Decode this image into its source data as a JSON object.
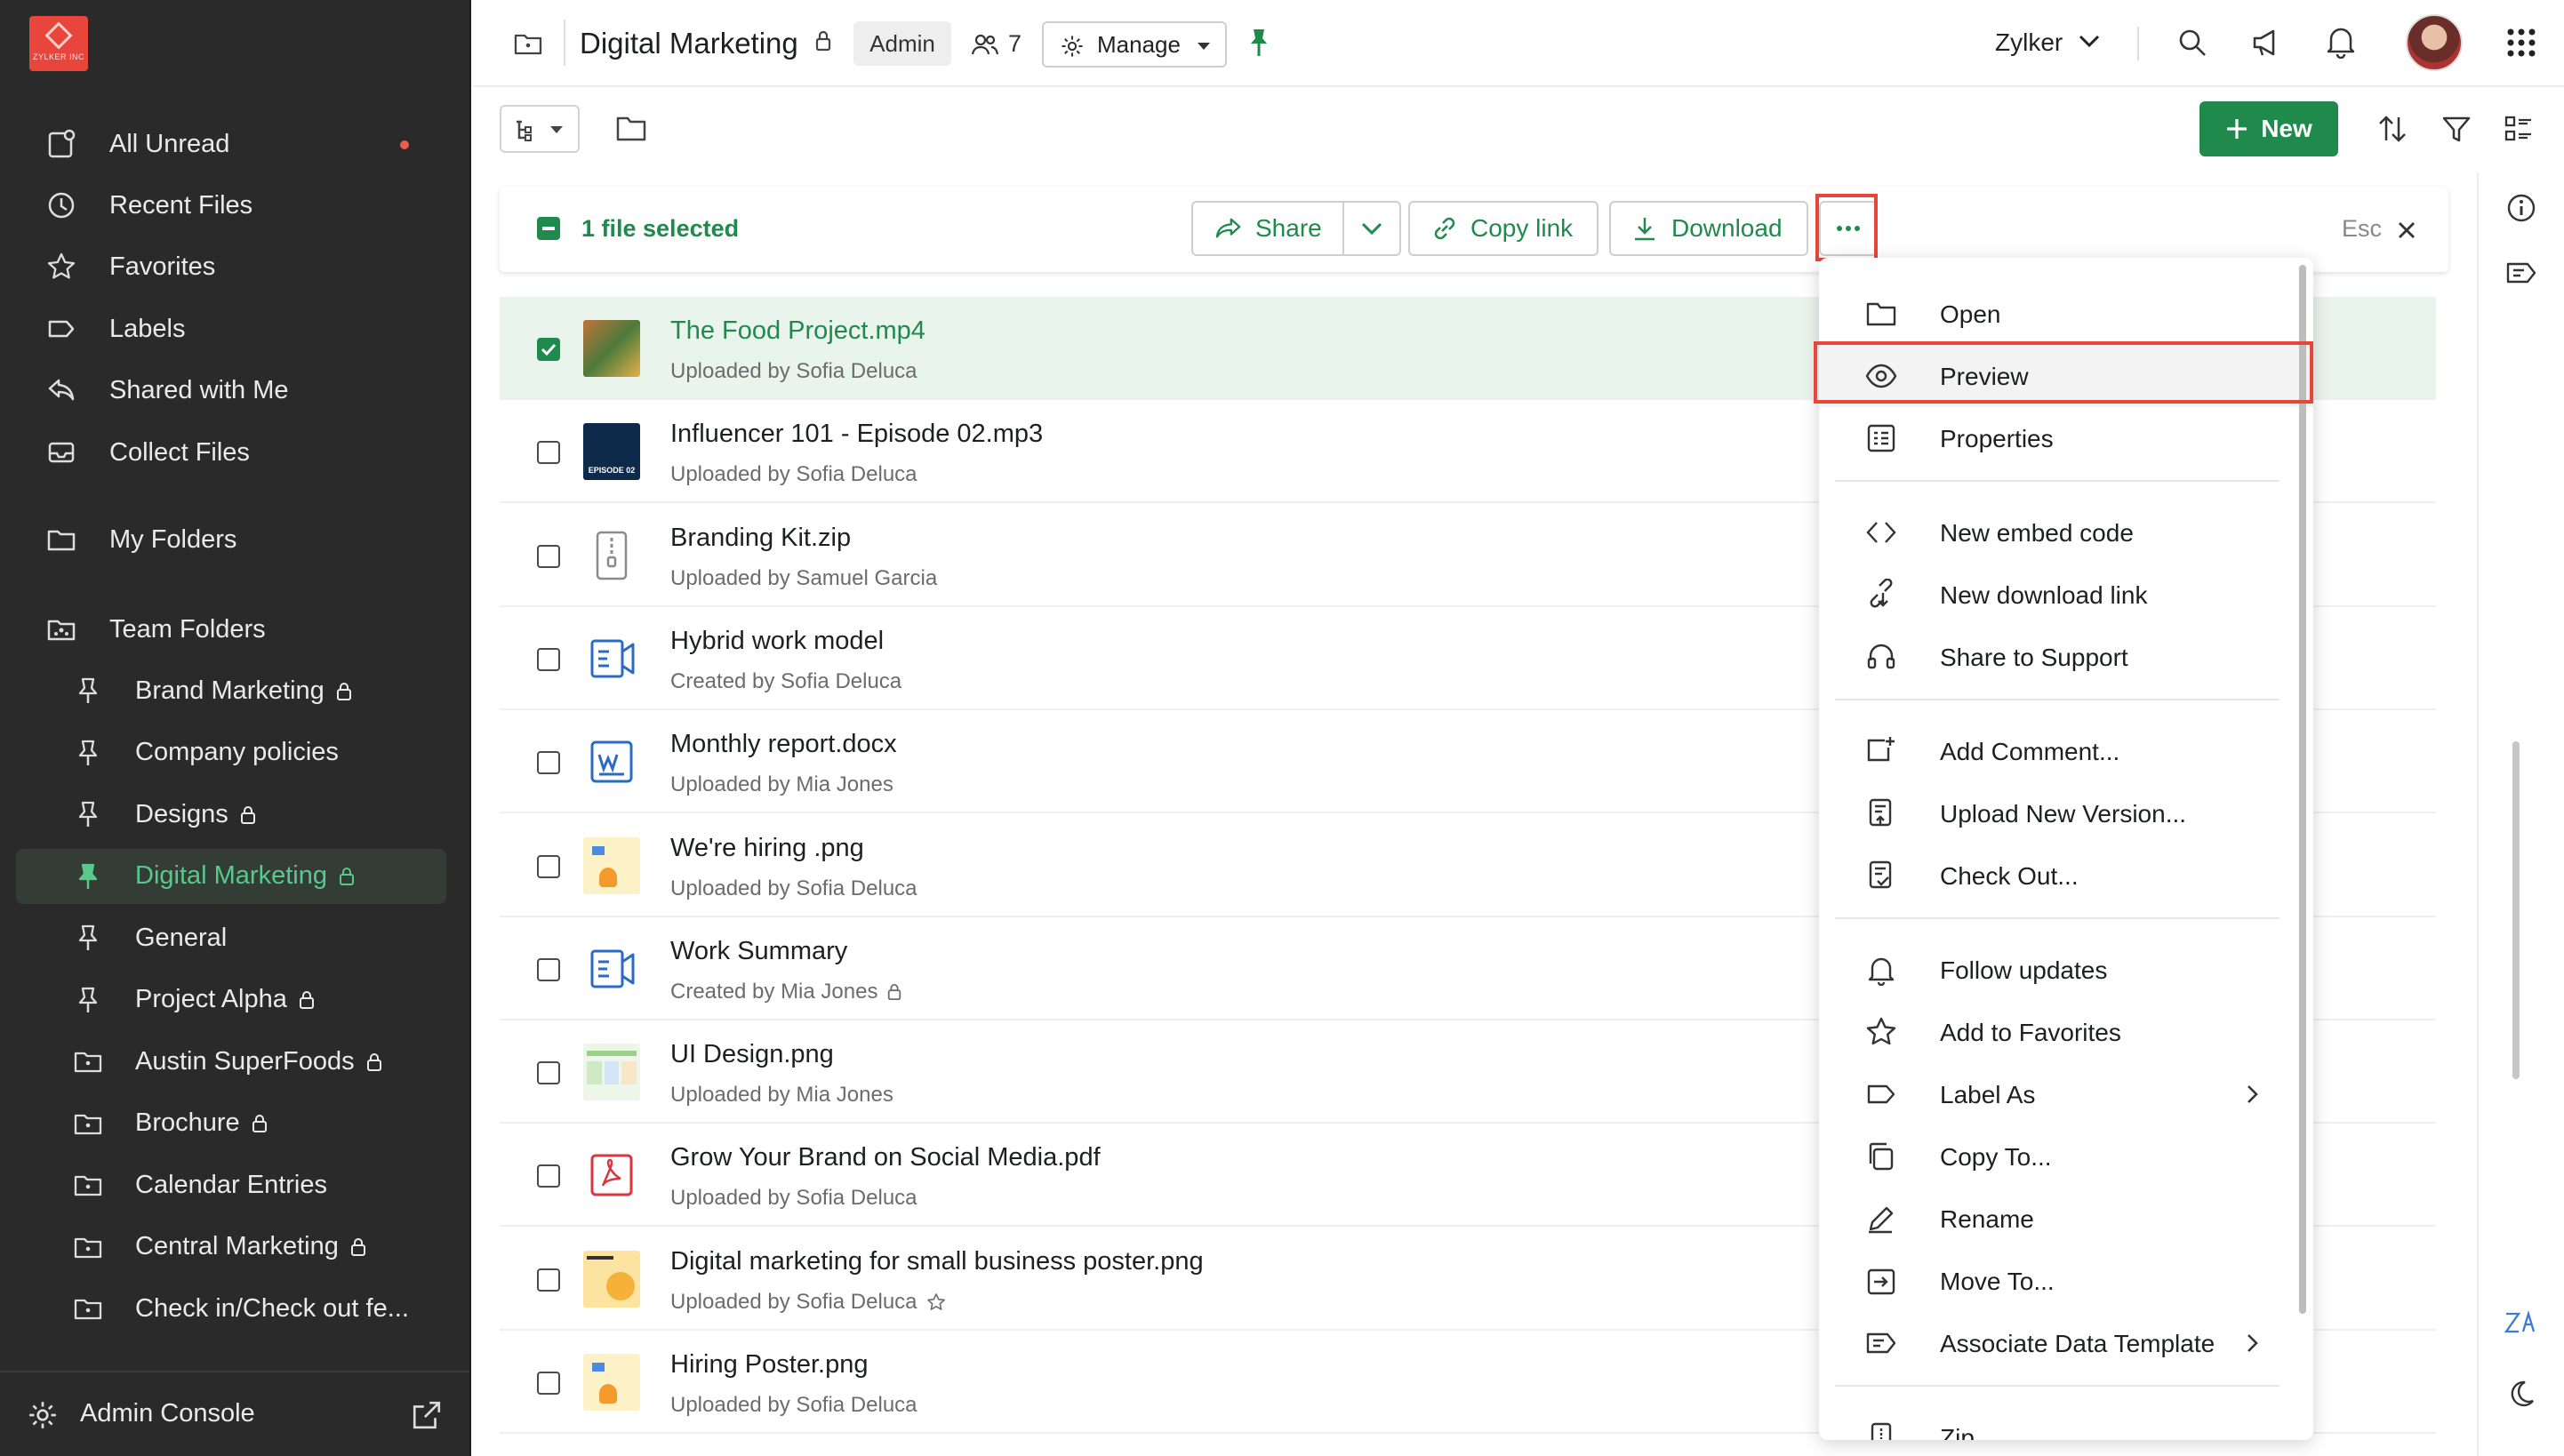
{
  "colors": {
    "accent": "#1f8a4c",
    "sidebar_bg": "#2a2a2a",
    "highlight": "#e8453c"
  },
  "logo_text": "ZYLKER INC",
  "sidebar": {
    "items": [
      {
        "label": "All Unread",
        "icon": "unread-icon"
      },
      {
        "label": "Recent Files",
        "icon": "clock-icon"
      },
      {
        "label": "Favorites",
        "icon": "star-icon"
      },
      {
        "label": "Labels",
        "icon": "label-icon"
      },
      {
        "label": "Shared with Me",
        "icon": "share-icon"
      },
      {
        "label": "Collect Files",
        "icon": "inbox-icon"
      },
      {
        "label": "My Folders",
        "icon": "folder-icon"
      },
      {
        "label": "Team Folders",
        "icon": "team-folder-icon"
      }
    ],
    "team_folders": [
      {
        "label": "Brand Marketing",
        "locked": true
      },
      {
        "label": "Company policies",
        "locked": false
      },
      {
        "label": "Designs",
        "locked": true
      },
      {
        "label": "Digital Marketing",
        "locked": true
      },
      {
        "label": "General",
        "locked": false
      },
      {
        "label": "Project Alpha",
        "locked": true
      },
      {
        "label": "Austin SuperFoods",
        "locked": true
      },
      {
        "label": "Brochure",
        "locked": true
      },
      {
        "label": "Calendar Entries",
        "locked": false
      },
      {
        "label": "Central Marketing",
        "locked": true
      },
      {
        "label": "Check in/Check out fe...",
        "locked": false
      }
    ],
    "footer_label": "Admin Console"
  },
  "header": {
    "title": "Digital Marketing",
    "role_badge": "Admin",
    "member_count": "7",
    "manage_label": "Manage",
    "org_name": "Zylker"
  },
  "toolbar": {
    "new_label": "New"
  },
  "selection": {
    "text": "1 file selected",
    "share_label": "Share",
    "copy_link_label": "Copy link",
    "download_label": "Download",
    "esc_label": "Esc"
  },
  "files": [
    {
      "name": "The Food Project.mp4",
      "meta": "Uploaded by Sofia Deluca",
      "selected": true
    },
    {
      "name": "Influencer 101 - Episode 02.mp3",
      "meta": "Uploaded by Sofia Deluca",
      "selected": false
    },
    {
      "name": "Branding Kit.zip",
      "meta": "Uploaded by Samuel Garcia",
      "selected": false
    },
    {
      "name": "Hybrid work model",
      "meta": "Created by Sofia Deluca",
      "selected": false
    },
    {
      "name": "Monthly report.docx",
      "meta": "Uploaded by Mia Jones",
      "selected": false
    },
    {
      "name": "We're hiring .png",
      "meta": "Uploaded by Sofia Deluca",
      "selected": false
    },
    {
      "name": "Work Summary",
      "meta": "Created by Mia Jones",
      "selected": false
    },
    {
      "name": "UI Design.png",
      "meta": "Uploaded by Mia Jones",
      "selected": false
    },
    {
      "name": "Grow Your Brand on Social Media.pdf",
      "meta": "Uploaded by Sofia Deluca",
      "selected": false
    },
    {
      "name": "Digital marketing for small business poster.png",
      "meta": "Uploaded by Sofia Deluca",
      "selected": false
    },
    {
      "name": "Hiring Poster.png",
      "meta": "Uploaded by Sofia Deluca",
      "selected": false
    }
  ],
  "context_menu": {
    "items": [
      "Open",
      "Preview",
      "Properties",
      "New embed code",
      "New download link",
      "Share to Support",
      "Add Comment...",
      "Upload New Version...",
      "Check Out...",
      "Follow updates",
      "Add to Favorites",
      "Label As",
      "Copy To...",
      "Rename",
      "Move To...",
      "Associate Data Template",
      "Zip"
    ]
  }
}
